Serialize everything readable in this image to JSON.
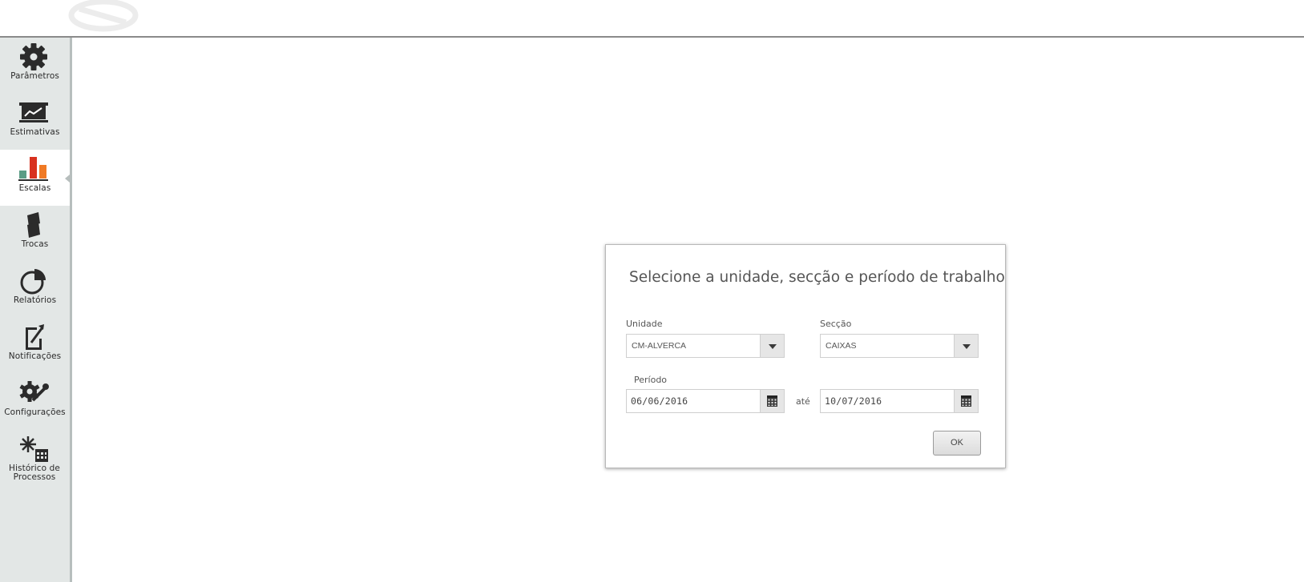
{
  "sidebar": {
    "items": [
      {
        "label": "Parâmetros",
        "icon": "gear-icon"
      },
      {
        "label": "Estimativas",
        "icon": "trend-chart-icon"
      },
      {
        "label": "Escalas",
        "icon": "bar-chart-icon",
        "active": true
      },
      {
        "label": "Trocas",
        "icon": "swap-icon"
      },
      {
        "label": "Relatórios",
        "icon": "pie-chart-icon"
      },
      {
        "label": "Notificações",
        "icon": "notification-doc-icon"
      },
      {
        "label": "Configurações",
        "icon": "settings-wrench-icon"
      },
      {
        "label": "Histórico de Processos",
        "icon": "process-calendar-icon"
      }
    ]
  },
  "dialog": {
    "title": "Selecione a unidade, secção e período de trabalho",
    "unidade": {
      "label": "Unidade",
      "value": "CM-ALVERCA"
    },
    "seccao": {
      "label": "Secção",
      "value": "CAIXAS"
    },
    "periodo": {
      "label": "Período",
      "from": "06/06/2016",
      "separator": "até",
      "to": "10/07/2016"
    },
    "ok_label": "OK"
  },
  "colors": {
    "sidebar_bg": "#e3e7e6",
    "active_bg": "#ffffff",
    "bar_green": "#5a9c85",
    "bar_red": "#d8311f",
    "bar_orange": "#f07a25"
  }
}
